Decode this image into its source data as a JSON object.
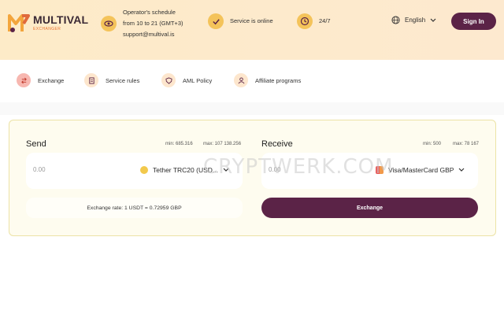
{
  "brand": {
    "name": "MULTIVAL",
    "sub": "EXCHANGER",
    "colors": {
      "accent": "#5b2347",
      "yellow": "#f4c35a",
      "header_bg": "#fdebc8"
    }
  },
  "header": {
    "schedule": {
      "line1": "Operator's schedule",
      "line2": "from 10 to 21 (GMT+3)",
      "line3": "support@multival.is",
      "icon": "eye-icon"
    },
    "status": {
      "label": "Service is online",
      "icon": "check-icon"
    },
    "availability": {
      "label": "24/7",
      "icon": "clock-icon"
    },
    "language": {
      "label": "English",
      "icon": "globe-icon"
    },
    "signin_label": "Sign In"
  },
  "nav": {
    "items": [
      {
        "label": "Exchange",
        "icon": "exchange-icon"
      },
      {
        "label": "Service rules",
        "icon": "document-icon"
      },
      {
        "label": "AML Policy",
        "icon": "shield-icon"
      },
      {
        "label": "Affiliate programs",
        "icon": "users-icon"
      }
    ]
  },
  "exchange": {
    "send": {
      "title": "Send",
      "min": "min: 685.316",
      "max": "max: 107 138.256",
      "amount_placeholder": "0.00",
      "currency": "Tether TRC20 (USD..."
    },
    "receive": {
      "title": "Receive",
      "min": "min: 500",
      "max": "max: 78 167",
      "amount_placeholder": "0.00",
      "currency": "Visa/MasterCard GBP"
    },
    "rate": "Exchange rate: 1 USDT = 0.72959 GBP",
    "button_label": "Exchange"
  },
  "watermark": "CRYPTWERK.COM"
}
